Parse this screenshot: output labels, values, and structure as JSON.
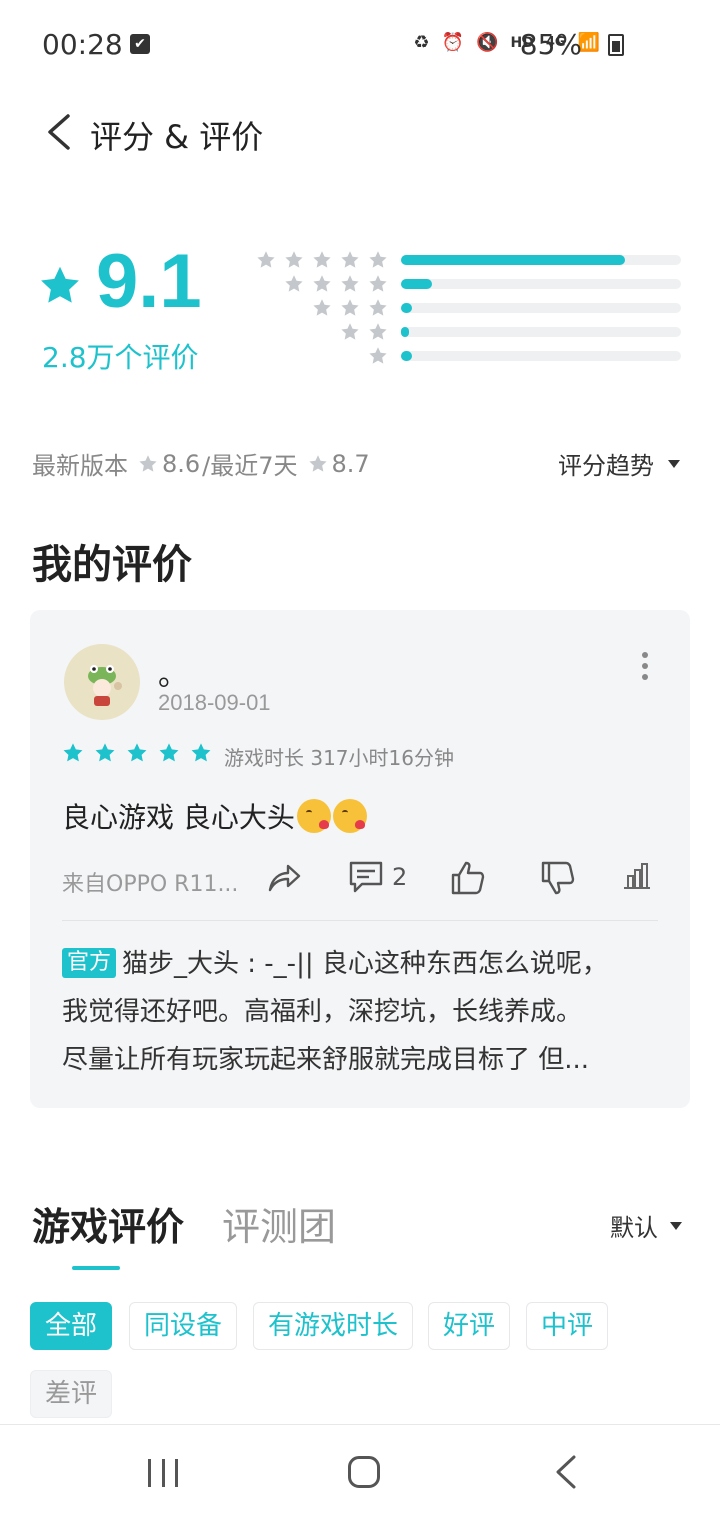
{
  "status_bar": {
    "time": "00:28",
    "battery": "85%",
    "network": "4G",
    "hd": "HD"
  },
  "header": {
    "title": "评分 & 评价"
  },
  "rating": {
    "score": "9.1",
    "count": "2.8万个评价",
    "distribution": [
      {
        "stars": 5,
        "fraction": 0.8
      },
      {
        "stars": 4,
        "fraction": 0.11
      },
      {
        "stars": 3,
        "fraction": 0.04
      },
      {
        "stars": 2,
        "fraction": 0.02
      },
      {
        "stars": 1,
        "fraction": 0.04
      }
    ],
    "version_label": "最新版本",
    "version_score": "8.6",
    "recent_label": "/最近7天",
    "recent_score": "8.7",
    "trend_label": "评分趋势"
  },
  "my_review": {
    "section_title": "我的评价",
    "username": "。",
    "date": "2018-09-01",
    "stars": 5,
    "playtime": "游戏时长 317小时16分钟",
    "text": "良心游戏 良心大头",
    "device": "来自OPPO R11...",
    "comment_count": "2",
    "reply_badge": "官方",
    "reply_line1": "猫步_大头 : -_-|| 良心这种东西怎么说呢，",
    "reply_line2": "我觉得还好吧。高福利，深挖坑，长线养成。",
    "reply_line3": "尽量让所有玩家玩起来舒服就完成目标了 但..."
  },
  "tabs": {
    "active": "游戏评价",
    "inactive": "评测团",
    "sort": "默认"
  },
  "filters": [
    "全部",
    "同设备",
    "有游戏时长",
    "好评",
    "中评",
    "差评"
  ],
  "colors": {
    "accent": "#1ec2cc",
    "star_grey": "#c4c8cc",
    "text_dark": "#222222",
    "text_muted": "#999999"
  }
}
